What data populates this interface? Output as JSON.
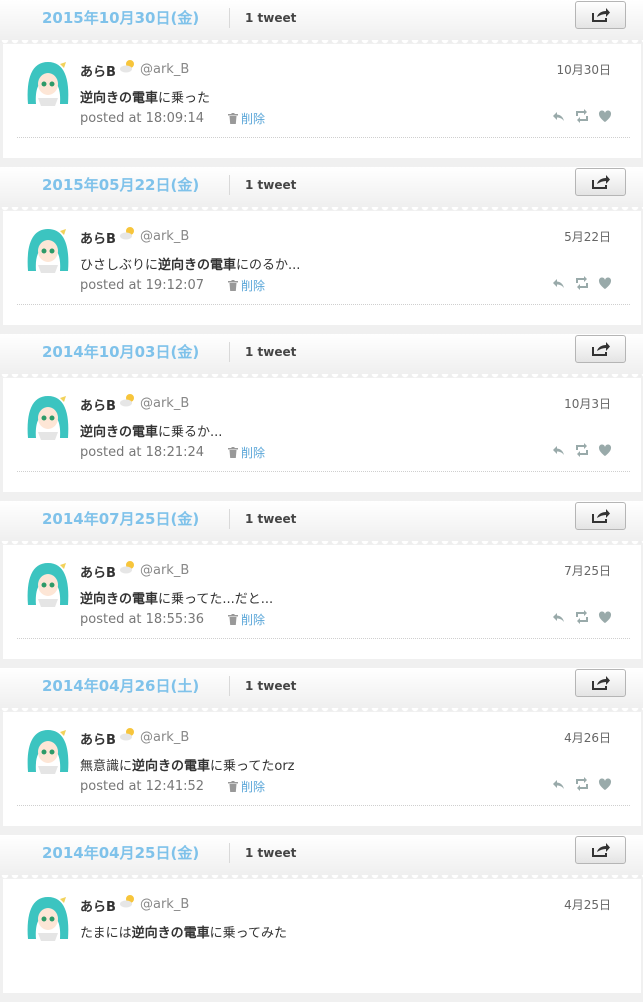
{
  "days": [
    {
      "date": "2015年10月30日(金)",
      "count": "1 tweet",
      "tweet": {
        "name": "あらB",
        "handle": "@ark_B",
        "date": "10月30日",
        "text_pre": "",
        "text_bold": "逆向きの電車",
        "text_post": "に乗った",
        "posted": "posted at 18:09:14",
        "delete": "削除"
      }
    },
    {
      "date": "2015年05月22日(金)",
      "count": "1 tweet",
      "tweet": {
        "name": "あらB",
        "handle": "@ark_B",
        "date": "5月22日",
        "text_pre": "ひさしぶりに",
        "text_bold": "逆向きの電車",
        "text_post": "にのるか...",
        "posted": "posted at 19:12:07",
        "delete": "削除"
      }
    },
    {
      "date": "2014年10月03日(金)",
      "count": "1 tweet",
      "tweet": {
        "name": "あらB",
        "handle": "@ark_B",
        "date": "10月3日",
        "text_pre": "",
        "text_bold": "逆向きの電車",
        "text_post": "に乗るか...",
        "posted": "posted at 18:21:24",
        "delete": "削除"
      }
    },
    {
      "date": "2014年07月25日(金)",
      "count": "1 tweet",
      "tweet": {
        "name": "あらB",
        "handle": "@ark_B",
        "date": "7月25日",
        "text_pre": "",
        "text_bold": "逆向きの電車",
        "text_post": "に乗ってた...だと...",
        "posted": "posted at 18:55:36",
        "delete": "削除"
      }
    },
    {
      "date": "2014年04月26日(土)",
      "count": "1 tweet",
      "tweet": {
        "name": "あらB",
        "handle": "@ark_B",
        "date": "4月26日",
        "text_pre": "無意識に",
        "text_bold": "逆向きの電車",
        "text_post": "に乗ってたorz",
        "posted": "posted at 12:41:52",
        "delete": "削除"
      }
    },
    {
      "date": "2014年04月25日(金)",
      "count": "1 tweet",
      "tweet": {
        "name": "あらB",
        "handle": "@ark_B",
        "date": "4月25日",
        "text_pre": "たまには",
        "text_bold": "逆向きの電車",
        "text_post": "に乗ってみた",
        "posted": "",
        "delete": ""
      }
    }
  ],
  "colors": {
    "date": "#7fc2ea",
    "link": "#5aa6d8",
    "avatar_hair": "#3cc4c0"
  },
  "icons": {
    "share": "share-icon",
    "reply": "reply-icon",
    "retweet": "retweet-icon",
    "favorite": "heart-icon",
    "delete": "trash-icon",
    "weather": "sun-cloud-icon"
  }
}
